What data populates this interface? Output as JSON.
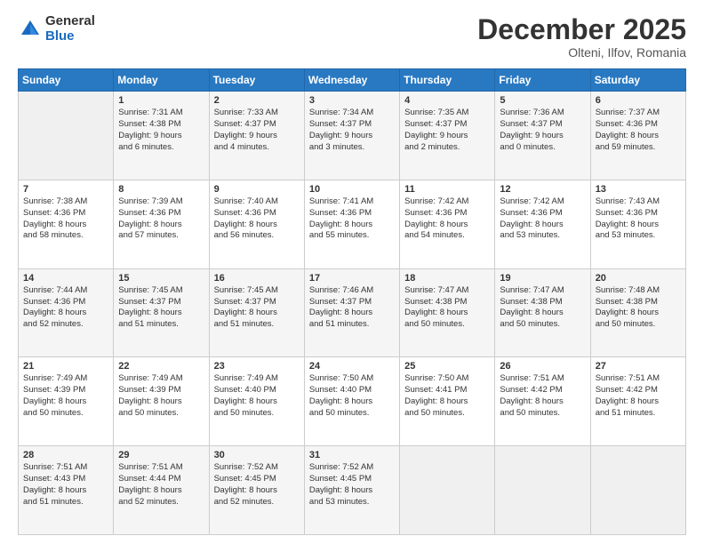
{
  "logo": {
    "general": "General",
    "blue": "Blue"
  },
  "title": "December 2025",
  "location": "Olteni, Ilfov, Romania",
  "days_header": [
    "Sunday",
    "Monday",
    "Tuesday",
    "Wednesday",
    "Thursday",
    "Friday",
    "Saturday"
  ],
  "weeks": [
    [
      {
        "day": "",
        "info": ""
      },
      {
        "day": "1",
        "info": "Sunrise: 7:31 AM\nSunset: 4:38 PM\nDaylight: 9 hours\nand 6 minutes."
      },
      {
        "day": "2",
        "info": "Sunrise: 7:33 AM\nSunset: 4:37 PM\nDaylight: 9 hours\nand 4 minutes."
      },
      {
        "day": "3",
        "info": "Sunrise: 7:34 AM\nSunset: 4:37 PM\nDaylight: 9 hours\nand 3 minutes."
      },
      {
        "day": "4",
        "info": "Sunrise: 7:35 AM\nSunset: 4:37 PM\nDaylight: 9 hours\nand 2 minutes."
      },
      {
        "day": "5",
        "info": "Sunrise: 7:36 AM\nSunset: 4:37 PM\nDaylight: 9 hours\nand 0 minutes."
      },
      {
        "day": "6",
        "info": "Sunrise: 7:37 AM\nSunset: 4:36 PM\nDaylight: 8 hours\nand 59 minutes."
      }
    ],
    [
      {
        "day": "7",
        "info": "Sunrise: 7:38 AM\nSunset: 4:36 PM\nDaylight: 8 hours\nand 58 minutes."
      },
      {
        "day": "8",
        "info": "Sunrise: 7:39 AM\nSunset: 4:36 PM\nDaylight: 8 hours\nand 57 minutes."
      },
      {
        "day": "9",
        "info": "Sunrise: 7:40 AM\nSunset: 4:36 PM\nDaylight: 8 hours\nand 56 minutes."
      },
      {
        "day": "10",
        "info": "Sunrise: 7:41 AM\nSunset: 4:36 PM\nDaylight: 8 hours\nand 55 minutes."
      },
      {
        "day": "11",
        "info": "Sunrise: 7:42 AM\nSunset: 4:36 PM\nDaylight: 8 hours\nand 54 minutes."
      },
      {
        "day": "12",
        "info": "Sunrise: 7:42 AM\nSunset: 4:36 PM\nDaylight: 8 hours\nand 53 minutes."
      },
      {
        "day": "13",
        "info": "Sunrise: 7:43 AM\nSunset: 4:36 PM\nDaylight: 8 hours\nand 53 minutes."
      }
    ],
    [
      {
        "day": "14",
        "info": "Sunrise: 7:44 AM\nSunset: 4:36 PM\nDaylight: 8 hours\nand 52 minutes."
      },
      {
        "day": "15",
        "info": "Sunrise: 7:45 AM\nSunset: 4:37 PM\nDaylight: 8 hours\nand 51 minutes."
      },
      {
        "day": "16",
        "info": "Sunrise: 7:45 AM\nSunset: 4:37 PM\nDaylight: 8 hours\nand 51 minutes."
      },
      {
        "day": "17",
        "info": "Sunrise: 7:46 AM\nSunset: 4:37 PM\nDaylight: 8 hours\nand 51 minutes."
      },
      {
        "day": "18",
        "info": "Sunrise: 7:47 AM\nSunset: 4:38 PM\nDaylight: 8 hours\nand 50 minutes."
      },
      {
        "day": "19",
        "info": "Sunrise: 7:47 AM\nSunset: 4:38 PM\nDaylight: 8 hours\nand 50 minutes."
      },
      {
        "day": "20",
        "info": "Sunrise: 7:48 AM\nSunset: 4:38 PM\nDaylight: 8 hours\nand 50 minutes."
      }
    ],
    [
      {
        "day": "21",
        "info": "Sunrise: 7:49 AM\nSunset: 4:39 PM\nDaylight: 8 hours\nand 50 minutes."
      },
      {
        "day": "22",
        "info": "Sunrise: 7:49 AM\nSunset: 4:39 PM\nDaylight: 8 hours\nand 50 minutes."
      },
      {
        "day": "23",
        "info": "Sunrise: 7:49 AM\nSunset: 4:40 PM\nDaylight: 8 hours\nand 50 minutes."
      },
      {
        "day": "24",
        "info": "Sunrise: 7:50 AM\nSunset: 4:40 PM\nDaylight: 8 hours\nand 50 minutes."
      },
      {
        "day": "25",
        "info": "Sunrise: 7:50 AM\nSunset: 4:41 PM\nDaylight: 8 hours\nand 50 minutes."
      },
      {
        "day": "26",
        "info": "Sunrise: 7:51 AM\nSunset: 4:42 PM\nDaylight: 8 hours\nand 50 minutes."
      },
      {
        "day": "27",
        "info": "Sunrise: 7:51 AM\nSunset: 4:42 PM\nDaylight: 8 hours\nand 51 minutes."
      }
    ],
    [
      {
        "day": "28",
        "info": "Sunrise: 7:51 AM\nSunset: 4:43 PM\nDaylight: 8 hours\nand 51 minutes."
      },
      {
        "day": "29",
        "info": "Sunrise: 7:51 AM\nSunset: 4:44 PM\nDaylight: 8 hours\nand 52 minutes."
      },
      {
        "day": "30",
        "info": "Sunrise: 7:52 AM\nSunset: 4:45 PM\nDaylight: 8 hours\nand 52 minutes."
      },
      {
        "day": "31",
        "info": "Sunrise: 7:52 AM\nSunset: 4:45 PM\nDaylight: 8 hours\nand 53 minutes."
      },
      {
        "day": "",
        "info": ""
      },
      {
        "day": "",
        "info": ""
      },
      {
        "day": "",
        "info": ""
      }
    ]
  ]
}
